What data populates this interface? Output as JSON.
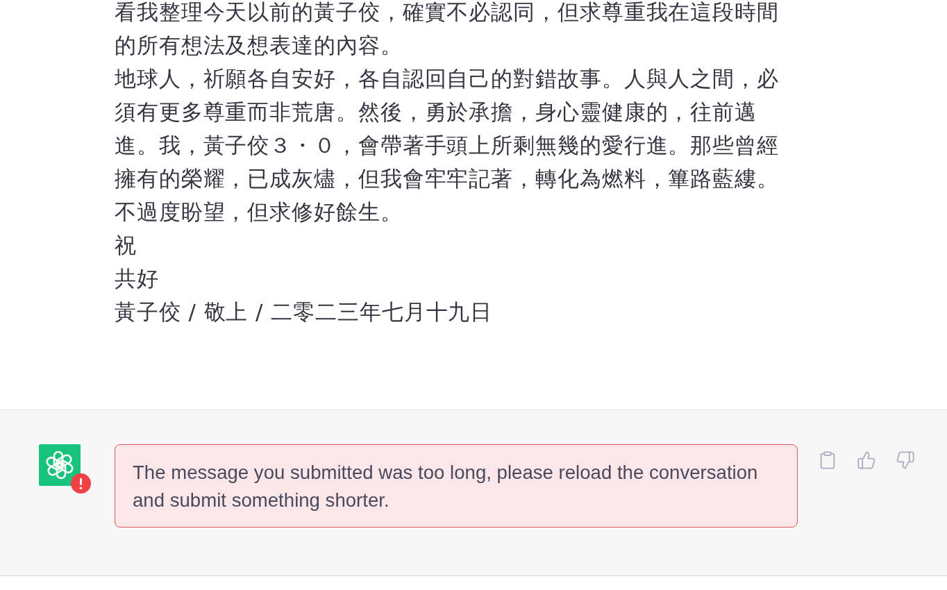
{
  "assistant_message": {
    "paragraphs": [
      {
        "lines": [
          "看我整理今天以前的黃子佼，確實不必認同，但求尊重我在這段時間",
          "的所有想法及想表達的內容。"
        ]
      },
      {
        "lines": [
          "地球人，祈願各自安好，各自認回自己的對錯故事。人與人之間，必",
          "須有更多尊重而非荒唐。然後，勇於承擔，身心靈健康的，往前邁",
          "進。我，黃子佼３・０，會帶著手頭上所剩無幾的愛行進。那些曾經",
          "擁有的榮耀，已成灰燼，但我會牢牢記著，轉化為燃料，篳路藍縷。",
          "不過度盼望，但求修好餘生。"
        ]
      },
      {
        "lines": [
          "祝"
        ]
      },
      {
        "lines": [
          "共好"
        ]
      },
      {
        "lines": [
          "黃子佼 / 敬上 / 二零二三年七月十九日"
        ]
      }
    ]
  },
  "error_message": {
    "text": "The message you submitted was too long, please reload the conversation and submit something shorter."
  }
}
